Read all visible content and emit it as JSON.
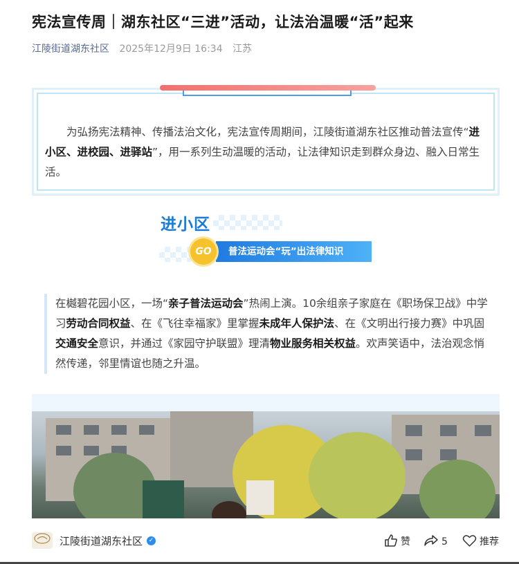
{
  "article": {
    "title": "宪法宣传周｜湖东社区“三进”活动，让法治温暖“活”起来",
    "account": "江陵街道湖东社区",
    "date": "2025年12月9日 16:34",
    "location": "江苏"
  },
  "intro": {
    "text_1": "为弘扬宪法精神、传播法治文化，宪法宣传周期间，江陵街道湖东社区推动普法宣传“",
    "bold_1": "进小区、进校园、进驿站",
    "text_2": "”，用一系列生动温暖的活动，让法律知识走到群众身边、融入日常生活。"
  },
  "section": {
    "title": "进小区",
    "go_label": "GO",
    "subtitle": "普法运动会“玩”出法律知识"
  },
  "paragraph": {
    "t1": "在樾碧花园小区，一场“",
    "b1": "亲子普法运动会",
    "t2": "”热闹上演。10余组亲子家庭在《职场保卫战》中学习",
    "b2": "劳动合同权益",
    "t3": "、在《飞往幸福家》里掌握",
    "b3": "未成年人保护法",
    "t4": "、在《文明出行接力赛》中巩固",
    "b4": "交通安全",
    "t5": "意识，并通过《家园守护联盟》理清",
    "b5": "物业服务相关权益",
    "t6": "。欢声笑语中，法治观念悄然传递，邻里情谊也随之升温。"
  },
  "footer": {
    "account": "江陵街道湖东社区",
    "avatar_icon": "community-logo-icon",
    "like_label": "赞",
    "share_count": "5",
    "recommend_label": "推荐"
  },
  "colors": {
    "accent_blue": "#1a7ad8",
    "link_blue": "#576b95",
    "bar_red": "#f26f6f",
    "go_yellow": "#f6c22b"
  }
}
